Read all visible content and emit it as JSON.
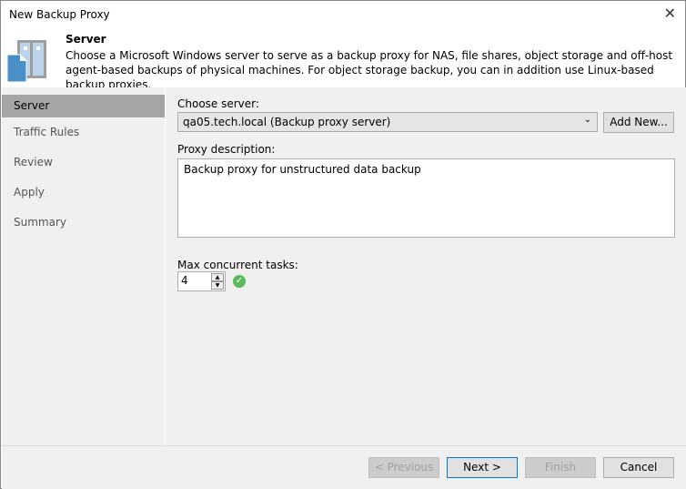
{
  "window": {
    "title": "New Backup Proxy"
  },
  "header": {
    "title": "Server",
    "description": "Choose a Microsoft Windows server to serve as a backup proxy for NAS, file shares, object storage and off-host agent-based backups of physical machines. For object storage backup, you can in addition use Linux-based backup proxies."
  },
  "sidebar": {
    "items": [
      {
        "label": "Server"
      },
      {
        "label": "Traffic Rules"
      },
      {
        "label": "Review"
      },
      {
        "label": "Apply"
      },
      {
        "label": "Summary"
      }
    ]
  },
  "form": {
    "choose_server_label": "Choose server:",
    "server_value": "qa05.tech.local (Backup proxy server)",
    "add_new_label": "Add New...",
    "proxy_description_label": "Proxy description:",
    "proxy_description_value": "Backup proxy for unstructured data backup",
    "max_tasks_label": "Max concurrent tasks:",
    "max_tasks_value": "4"
  },
  "footer": {
    "previous": "< Previous",
    "next": "Next >",
    "finish": "Finish",
    "cancel": "Cancel"
  }
}
